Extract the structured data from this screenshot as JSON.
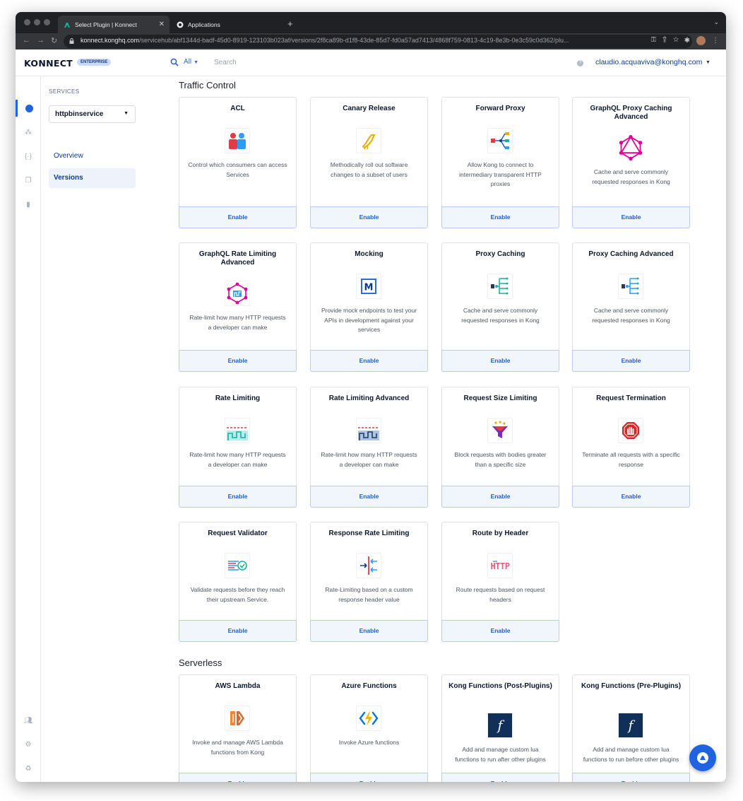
{
  "browser": {
    "tabs": [
      {
        "title": "Select Plugin | Konnect",
        "active": true
      },
      {
        "title": "Applications",
        "active": false
      }
    ],
    "url_host": "konnect.konghq.com",
    "url_path": "/servicehub/abf1344d-badf-45d0-8919-123103b023af/versions/2f8ca89b-d1f8-43de-85d7-fd0a57ad7413/4868f759-0813-4c19-8e3b-0e3c59c0d362/plu..."
  },
  "header": {
    "logo": "KONNECT",
    "badge": "ENTERPRISE",
    "search_scope": "All",
    "search_placeholder": "Search",
    "user_email": "claudio.acquaviva@konghq.com"
  },
  "sidebar": {
    "section_label": "SERVICES",
    "selected_service": "httpbinservice",
    "links": [
      {
        "label": "Overview",
        "active": false
      },
      {
        "label": "Versions",
        "active": true
      }
    ]
  },
  "sections": [
    {
      "title": "Traffic Control",
      "cards": [
        {
          "title": "ACL",
          "icon": "acl-icon",
          "desc": "Control which consumers can access Services",
          "button": "Enable"
        },
        {
          "title": "Canary Release",
          "icon": "canary-icon",
          "desc": "Methodically roll out software changes to a subset of users",
          "button": "Enable"
        },
        {
          "title": "Forward Proxy",
          "icon": "forward-proxy-icon",
          "desc": "Allow Kong to connect to intermediary transparent HTTP proxies",
          "button": "Enable"
        },
        {
          "title": "GraphQL Proxy Caching Advanced",
          "icon": "graphql-icon",
          "desc": "Cache and serve commonly requested responses in Kong",
          "button": "Enable"
        },
        {
          "title": "GraphQL Rate Limiting Advanced",
          "icon": "graphql-rate-icon",
          "desc": "Rate-limit how many HTTP requests a developer can make",
          "button": "Enable"
        },
        {
          "title": "Mocking",
          "icon": "mocking-icon",
          "desc": "Provide mock endpoints to test your APIs in development against your services",
          "button": "Enable"
        },
        {
          "title": "Proxy Caching",
          "icon": "proxy-cache-icon",
          "desc": "Cache and serve commonly requested responses in Kong",
          "button": "Enable"
        },
        {
          "title": "Proxy Caching Advanced",
          "icon": "proxy-cache-adv-icon",
          "desc": "Cache and serve commonly requested responses in Kong",
          "button": "Enable"
        },
        {
          "title": "Rate Limiting",
          "icon": "rate-limit-icon",
          "desc": "Rate-limit how many HTTP requests a developer can make",
          "button": "Enable"
        },
        {
          "title": "Rate Limiting Advanced",
          "icon": "rate-limit-adv-icon",
          "desc": "Rate-limit how many HTTP requests a developer can make",
          "button": "Enable"
        },
        {
          "title": "Request Size Limiting",
          "icon": "funnel-icon",
          "desc": "Block requests with bodies greater than a specific size",
          "button": "Enable"
        },
        {
          "title": "Request Termination",
          "icon": "stop-hand-icon",
          "desc": "Terminate all requests with a specific response",
          "button": "Enable"
        },
        {
          "title": "Request Validator",
          "icon": "validator-icon",
          "desc": "Validate requests before they reach their upstream Service.",
          "button": "Enable"
        },
        {
          "title": "Response Rate Limiting",
          "icon": "response-rate-icon",
          "desc": "Rate-Limiting based on a custom response header value",
          "button": "Enable"
        },
        {
          "title": "Route by Header",
          "icon": "http-icon",
          "desc": "Route requests based on request headers",
          "button": "Enable"
        }
      ]
    },
    {
      "title": "Serverless",
      "cards": [
        {
          "title": "AWS Lambda",
          "icon": "aws-lambda-icon",
          "desc": "Invoke and manage AWS Lambda functions from Kong",
          "button": "Enable"
        },
        {
          "title": "Azure Functions",
          "icon": "azure-functions-icon",
          "desc": "Invoke Azure functions",
          "button": "Enable"
        },
        {
          "title": "Kong Functions (Post-Plugins)",
          "icon": "kong-function-icon",
          "desc": "Add and manage custom lua functions to run after other plugins",
          "button": "Enable"
        },
        {
          "title": "Kong Functions (Pre-Plugins)",
          "icon": "kong-function-icon",
          "desc": "Add and manage custom lua functions to run before other plugins",
          "button": "Enable"
        }
      ]
    }
  ]
}
